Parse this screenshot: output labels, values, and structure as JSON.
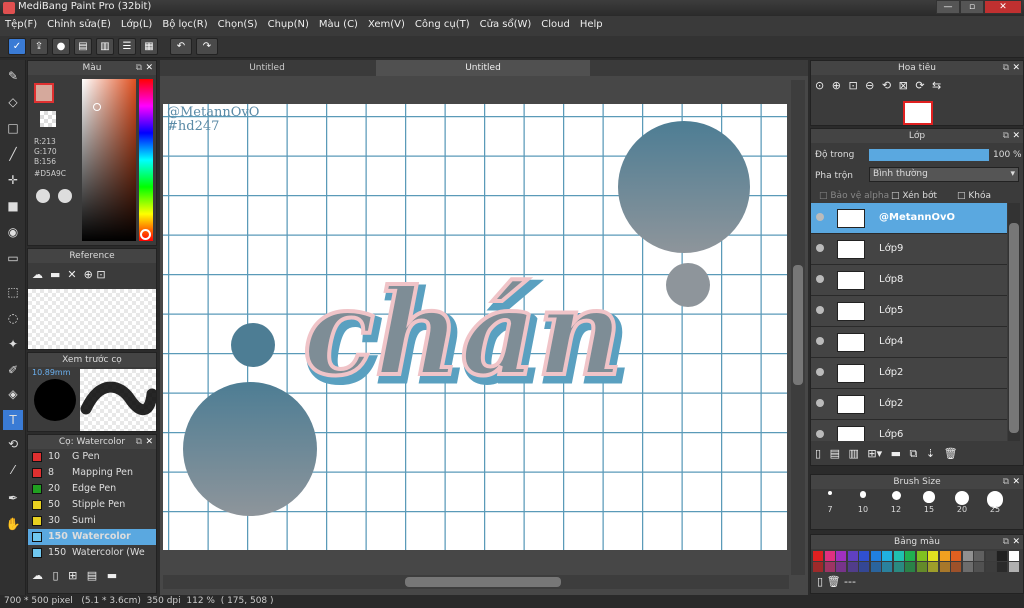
{
  "app": {
    "title": "MediBang Paint Pro (32bit)"
  },
  "menu": [
    "Tệp(F)",
    "Chỉnh sửa(E)",
    "Lớp(L)",
    "Bộ lọc(R)",
    "Chọn(S)",
    "Chụp(N)",
    "Màu (C)",
    "Xem(V)",
    "Công cụ(T)",
    "Cửa sổ(W)",
    "Cloud",
    "Help"
  ],
  "color_panel": {
    "title": "Màu",
    "r": "R:213",
    "g": "G:170",
    "b": "B:156",
    "hex": "#D5A9C"
  },
  "reference_panel": {
    "title": "Reference"
  },
  "preview_panel": {
    "title": "Xem trước cọ",
    "size": "10.89mm"
  },
  "brush_panel": {
    "title": "Cọ: Watercolor",
    "items": [
      {
        "size": "10",
        "name": "G Pen",
        "color": "#e03030"
      },
      {
        "size": "8",
        "name": "Mapping Pen",
        "color": "#e03030"
      },
      {
        "size": "20",
        "name": "Edge Pen",
        "color": "#20a020"
      },
      {
        "size": "50",
        "name": "Stipple Pen",
        "color": "#e8d020"
      },
      {
        "size": "30",
        "name": "Sumi",
        "color": "#e8d020"
      },
      {
        "size": "150",
        "name": "Watercolor",
        "color": "#70c8f0"
      },
      {
        "size": "150",
        "name": "Watercolor (We",
        "color": "#70c8f0"
      }
    ]
  },
  "tabs": [
    "Untitled",
    "Untitled"
  ],
  "canvas": {
    "watermark1": "@MetannOvO",
    "watermark2": "#hd247",
    "word": "chán"
  },
  "navigator": {
    "title": "Hoa tiêu"
  },
  "layer_panel": {
    "title": "Lớp",
    "opacity_label": "Độ trong",
    "opacity_value": "100 %",
    "opacity": 1.0,
    "blend_label": "Pha trộn",
    "blend_value": "Bình thường",
    "protect_alpha": "Bảo vệ alpha",
    "clipping": "Xén bớt",
    "lock": "Khóa",
    "layers": [
      "@MetannOvO",
      "Lớp9",
      "Lớp8",
      "Lớp5",
      "Lớp4",
      "Lớp2",
      "Lớp2",
      "Lớp6"
    ]
  },
  "brush_size": {
    "title": "Brush Size",
    "sizes": [
      "7",
      "10",
      "12",
      "15",
      "20",
      "25"
    ]
  },
  "palette": {
    "title": "Bảng màu",
    "extra": "---",
    "colors": [
      "#e02020",
      "#e03080",
      "#a030c0",
      "#6040c0",
      "#3050d0",
      "#2080e0",
      "#20b0e0",
      "#20c0b0",
      "#20b050",
      "#80c020",
      "#e0e020",
      "#f0a020",
      "#e06020",
      "#909090",
      "#606060",
      "#404040",
      "#202020",
      "#ffffff"
    ]
  },
  "status": {
    "size": "700 * 500 pixel",
    "cm": "(5.1 * 3.6cm)",
    "dpi": "350 dpi",
    "zoom": "112 %",
    "pos": "( 175, 508 )"
  }
}
